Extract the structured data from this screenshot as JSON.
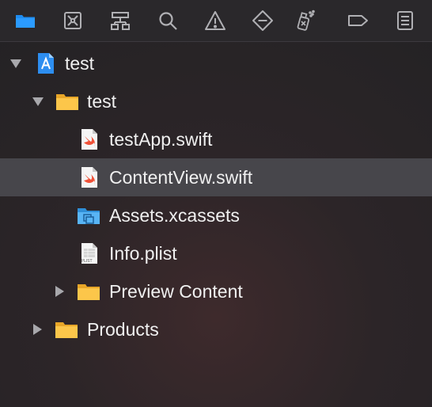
{
  "toolbar": {
    "tabs": [
      {
        "name": "folder-icon",
        "active": true
      },
      {
        "name": "source-control-icon",
        "active": false
      },
      {
        "name": "hierarchy-icon",
        "active": false
      },
      {
        "name": "search-icon",
        "active": false
      },
      {
        "name": "warning-icon",
        "active": false
      },
      {
        "name": "test-diamond-icon",
        "active": false
      },
      {
        "name": "debug-spray-icon",
        "active": false
      },
      {
        "name": "breakpoint-tag-icon",
        "active": false
      },
      {
        "name": "report-list-icon",
        "active": false
      }
    ],
    "active_color": "#1e8cf0",
    "inactive_color": "#b0b0b4"
  },
  "tree": {
    "items": [
      {
        "label": "test",
        "icon": "xcode-project-icon",
        "level": 0,
        "expanded": true,
        "selected": false
      },
      {
        "label": "test",
        "icon": "folder-icon",
        "level": 1,
        "expanded": true,
        "selected": false
      },
      {
        "label": "testApp.swift",
        "icon": "swift-file-icon",
        "level": 2,
        "selected": false
      },
      {
        "label": "ContentView.swift",
        "icon": "swift-file-icon",
        "level": 2,
        "selected": true
      },
      {
        "label": "Assets.xcassets",
        "icon": "asset-catalog-icon",
        "level": 2,
        "selected": false
      },
      {
        "label": "Info.plist",
        "icon": "plist-file-icon",
        "level": 2,
        "selected": false
      },
      {
        "label": "Preview Content",
        "icon": "folder-icon",
        "level": 2,
        "expanded": false,
        "selected": false
      },
      {
        "label": "Products",
        "icon": "folder-icon",
        "level": 1,
        "expanded": false,
        "selected": false
      }
    ],
    "plist_badge": "PLIST"
  }
}
